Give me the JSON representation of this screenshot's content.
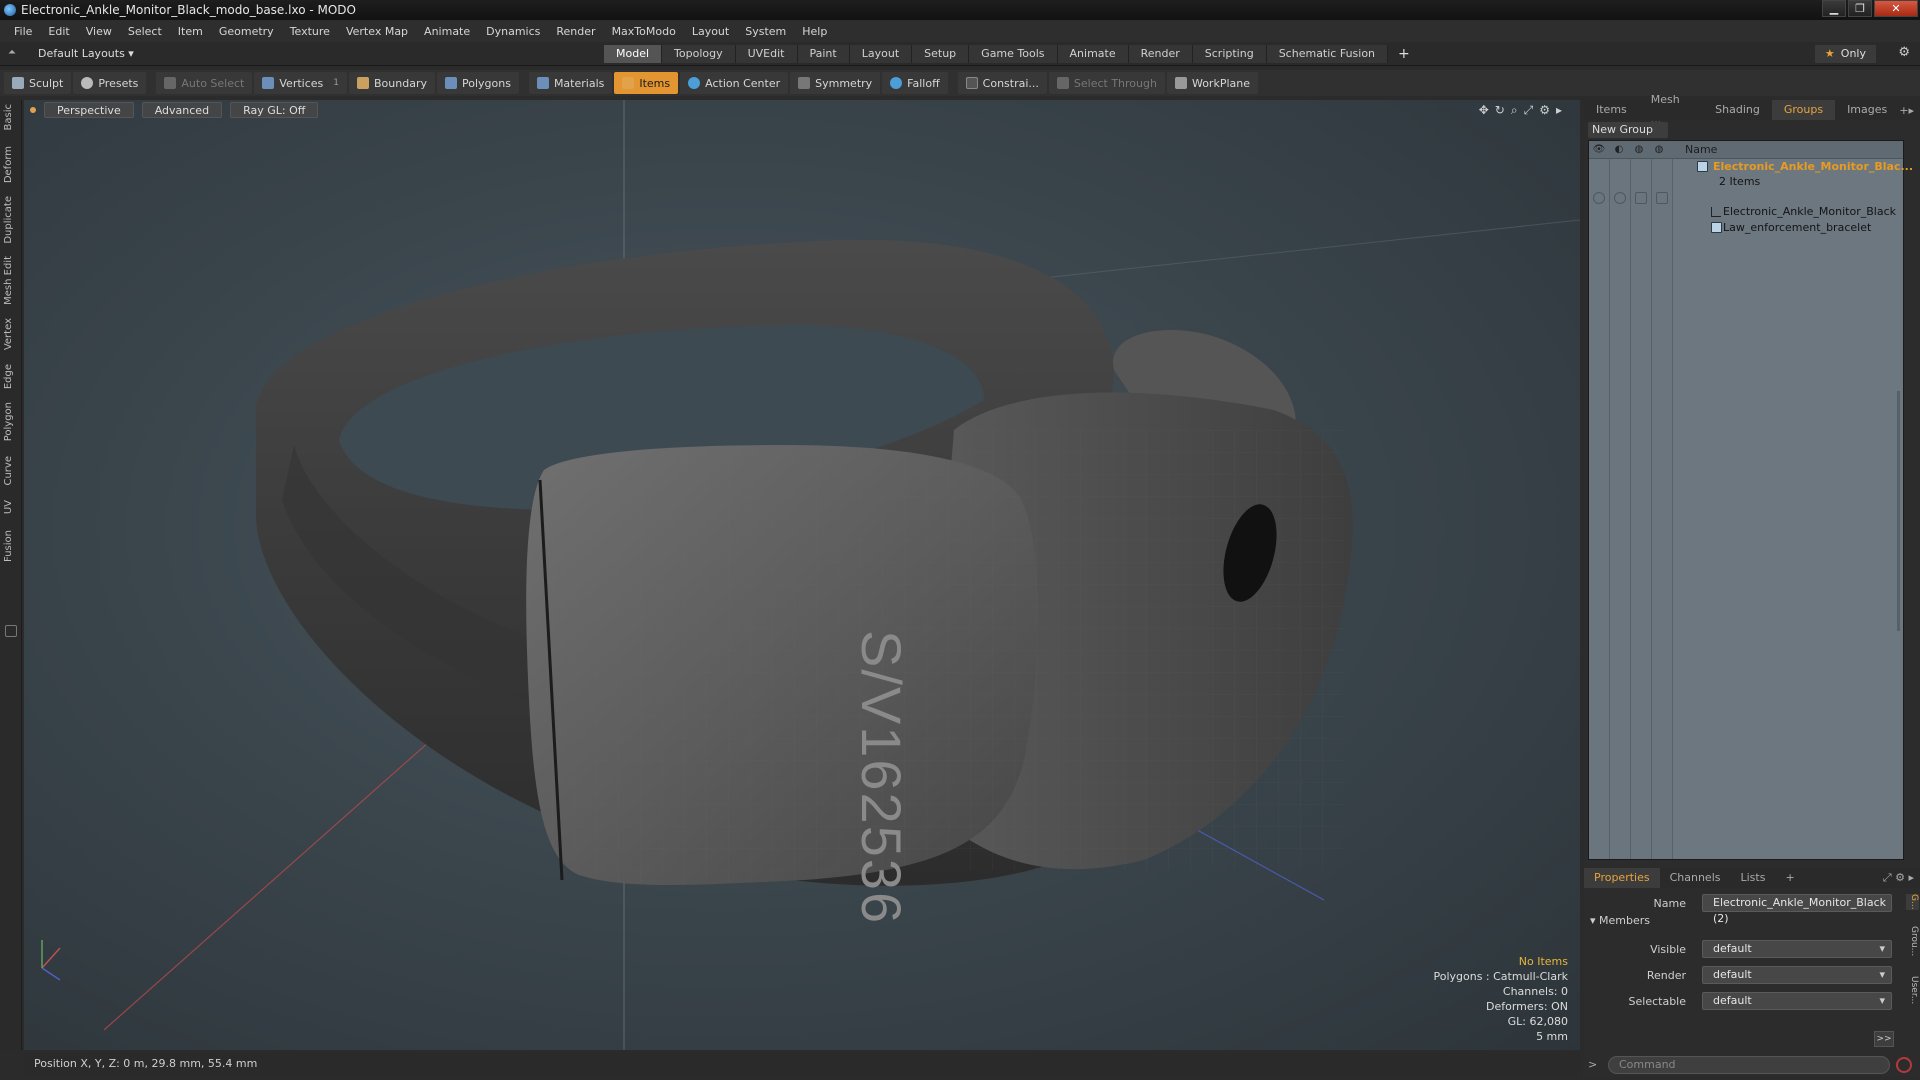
{
  "window": {
    "title": "Electronic_Ankle_Monitor_Black_modo_base.lxo - MODO"
  },
  "menu": [
    "File",
    "Edit",
    "View",
    "Select",
    "Item",
    "Geometry",
    "Texture",
    "Vertex Map",
    "Animate",
    "Dynamics",
    "Render",
    "MaxToModo",
    "Layout",
    "System",
    "Help"
  ],
  "layoutbar": {
    "layouts_label": "Default Layouts ▾",
    "tabs": [
      "Model",
      "Topology",
      "UVEdit",
      "Paint",
      "Layout",
      "Setup",
      "Game Tools",
      "Animate",
      "Render",
      "Scripting",
      "Schematic Fusion"
    ],
    "active_tab": "Model",
    "only_label": "Only"
  },
  "toolbar": {
    "sculpt": "Sculpt",
    "presets": "Presets",
    "auto_select": "Auto Select",
    "vertices": "Vertices",
    "vertices_count": "1",
    "boundary": "Boundary",
    "polygons": "Polygons",
    "materials": "Materials",
    "items": "Items",
    "action_center": "Action Center",
    "symmetry": "Symmetry",
    "falloff": "Falloff",
    "constraints": "Constrai...",
    "select_through": "Select Through",
    "workplane": "WorkPlane"
  },
  "left_tabs": [
    "Basic",
    "Deform",
    "Duplicate",
    "Mesh Edit",
    "Vertex",
    "Edge",
    "Polygon",
    "Curve",
    "UV",
    "Fusion"
  ],
  "viewport": {
    "view_mode": "Perspective",
    "shading": "Advanced",
    "raygl": "Ray GL: Off",
    "model_text": "S/V162536",
    "info": {
      "no_items": "No Items",
      "polygons": "Polygons : Catmull-Clark",
      "channels": "Channels: 0",
      "deformers": "Deformers: ON",
      "gl": "GL: 62,080",
      "scale": "5 mm"
    }
  },
  "status": {
    "position": "Position X, Y, Z:  0 m, 29.8 mm, 55.4 mm"
  },
  "groups_panel": {
    "tabs": [
      "Items",
      "Mesh ...",
      "Shading",
      "Groups",
      "Images"
    ],
    "active_tab": "Groups",
    "new_group": "New Group",
    "name_header": "Name",
    "group_name": "Electronic_Ankle_Monitor_Blac...",
    "group_count": "2 Items",
    "members": [
      "Electronic_Ankle_Monitor_Black",
      "Law_enforcement_bracelet"
    ]
  },
  "properties_panel": {
    "tabs": [
      "Properties",
      "Channels",
      "Lists"
    ],
    "active_tab": "Properties",
    "name_label": "Name",
    "name_value": "Electronic_Ankle_Monitor_Black (2)",
    "members_label": "Members",
    "visible_label": "Visible",
    "visible_value": "default",
    "render_label": "Render",
    "render_value": "default",
    "selectable_label": "Selectable",
    "selectable_value": "default",
    "expand": ">>",
    "side_tabs": [
      "G...",
      "Grou...",
      "User..."
    ]
  },
  "command": {
    "placeholder": "Command"
  }
}
